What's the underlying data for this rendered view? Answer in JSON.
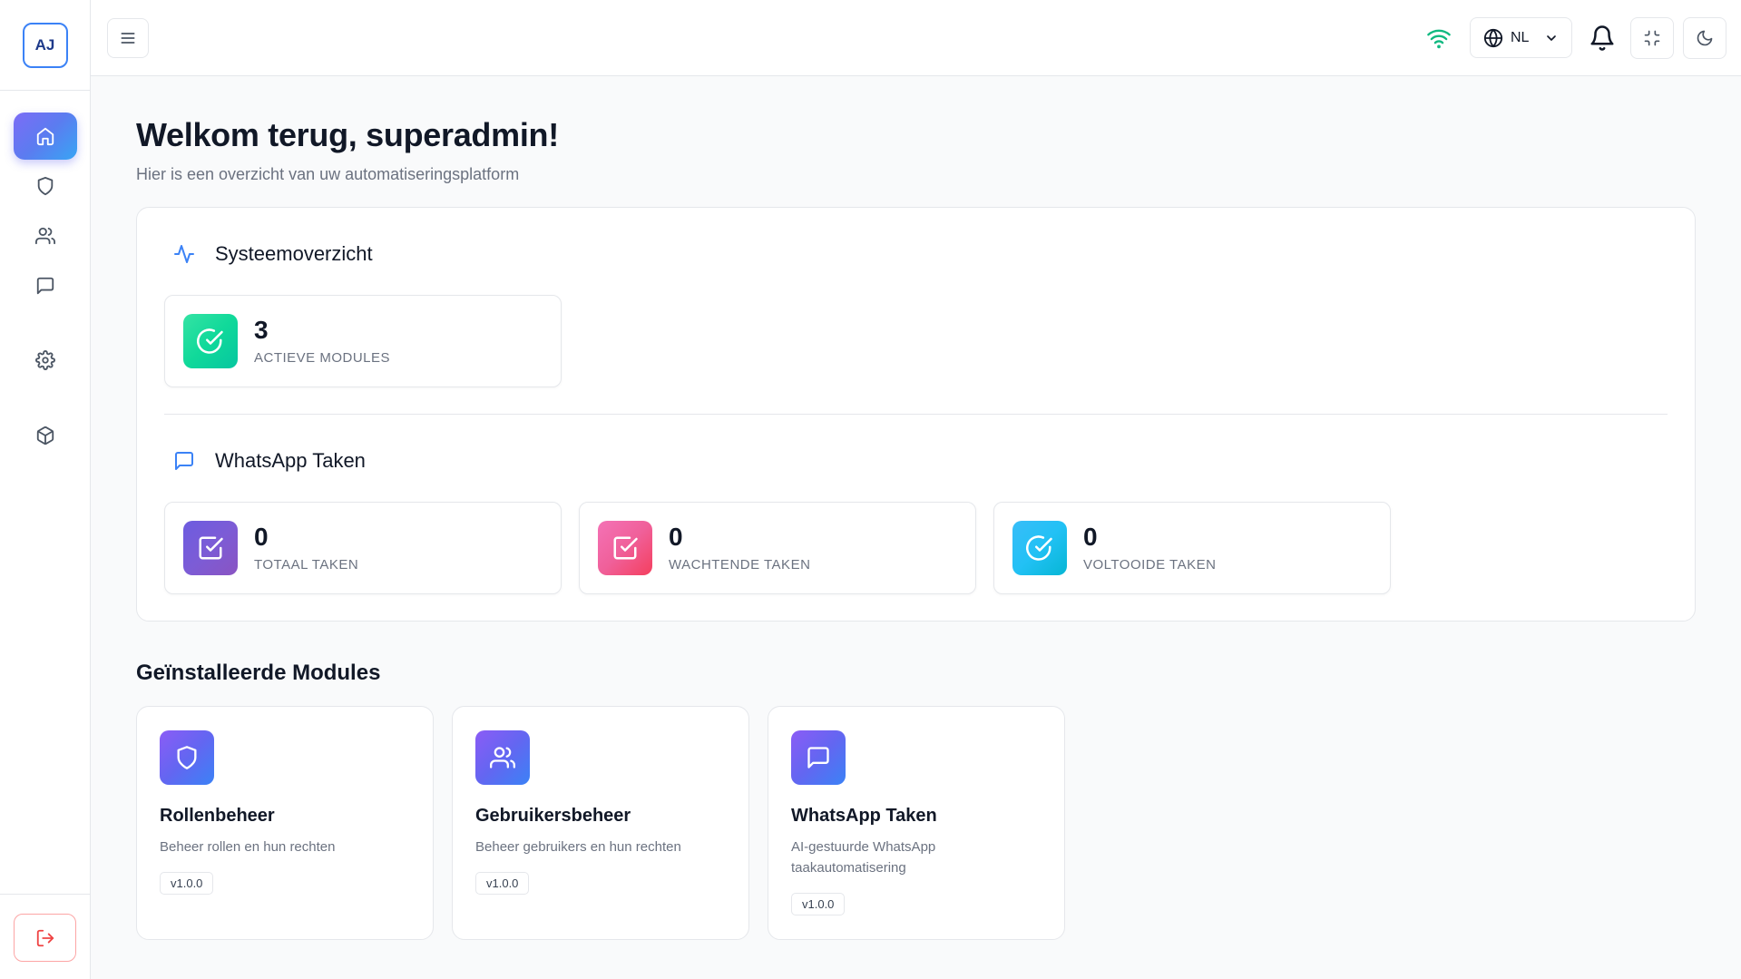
{
  "sidebar": {
    "logo": "AJ",
    "items": [
      {
        "name": "home",
        "icon": "home-icon",
        "active": true
      },
      {
        "name": "roles",
        "icon": "shield-icon"
      },
      {
        "name": "users",
        "icon": "users-icon"
      },
      {
        "name": "messages",
        "icon": "message-square-icon"
      },
      {
        "name": "settings",
        "icon": "gear-icon"
      },
      {
        "name": "modules",
        "icon": "package-icon"
      }
    ],
    "logout_icon": "logout-icon"
  },
  "header": {
    "language": "NL",
    "status_color": "#10b981"
  },
  "main": {
    "title": "Welkom terug, superadmin!",
    "subtitle": "Hier is een overzicht van uw automatiseringsplatform",
    "system_overview": {
      "title": "Systeemoverzicht",
      "stats": [
        {
          "value": "3",
          "label": "Actieve modules",
          "color": "#10d99a"
        }
      ]
    },
    "whatsapp_tasks": {
      "title": "WhatsApp Taken",
      "stats": [
        {
          "value": "0",
          "label": "Totaal taken",
          "color": "#7c5cd6"
        },
        {
          "value": "0",
          "label": "Wachtende taken",
          "color": "#f0609a"
        },
        {
          "value": "0",
          "label": "Voltooide taken",
          "color": "#22c1f5"
        }
      ]
    },
    "installed_modules": {
      "title": "Geïnstalleerde Modules",
      "modules": [
        {
          "name": "Rollenbeheer",
          "description": "Beheer rollen en hun rechten",
          "version": "v1.0.0",
          "icon": "shield-icon"
        },
        {
          "name": "Gebruikersbeheer",
          "description": "Beheer gebruikers en hun rechten",
          "version": "v1.0.0",
          "icon": "users-icon"
        },
        {
          "name": "WhatsApp Taken",
          "description": "AI-gestuurde WhatsApp taakautomatisering",
          "version": "v1.0.0",
          "icon": "message-square-icon"
        }
      ]
    }
  }
}
